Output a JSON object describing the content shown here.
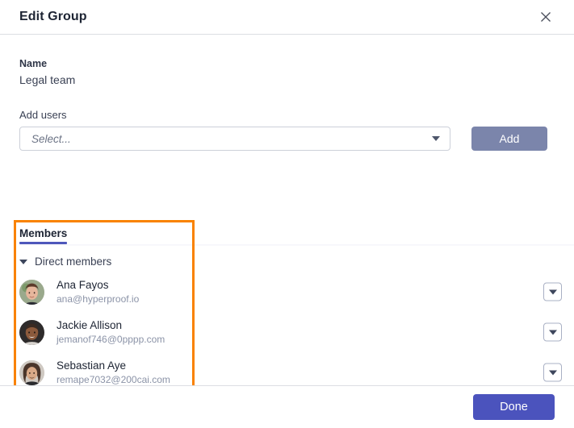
{
  "dialog": {
    "title": "Edit Group",
    "close_icon": "close-icon"
  },
  "form": {
    "name_label": "Name",
    "name_value": "Legal team",
    "add_users_label": "Add users",
    "select_placeholder": "Select...",
    "select_value": "",
    "add_button_label": "Add"
  },
  "members": {
    "tabs": [
      {
        "label": "Members",
        "active": true
      }
    ],
    "group_label": "Direct members",
    "rows": [
      {
        "name": "Ana Fayos",
        "email": "ana@hyperproof.io",
        "avatar_bg": "#9aa98c",
        "avatar_skin": "#e6b69c",
        "avatar_hair": "#5b3a2a",
        "avatar_shirt": "#2b2b33"
      },
      {
        "name": "Jackie Allison",
        "email": "jemanof746@0pppp.com",
        "avatar_bg": "#2e2b2b",
        "avatar_skin": "#8c5a3c",
        "avatar_hair": "#3a2a22",
        "avatar_shirt": "#d8d4cf"
      },
      {
        "name": "Sebastian Aye",
        "email": "remape7032@200cai.com",
        "avatar_bg": "#cfc9c2",
        "avatar_skin": "#d9a987",
        "avatar_hair": "#4a352a",
        "avatar_shirt": "#2a2a2e"
      }
    ],
    "row_menu_icon": "chevron-down-icon"
  },
  "footer": {
    "done_label": "Done"
  },
  "annotation": {
    "highlight_color": "#f98200"
  },
  "colors": {
    "accent": "#4e57bb",
    "primary_button": "#4b53bd",
    "muted_button": "#7b85ab",
    "highlight": "#f98200"
  }
}
